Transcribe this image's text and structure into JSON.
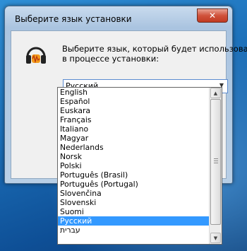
{
  "dialog": {
    "title": "Выберите язык установки",
    "close_glyph": "✕",
    "icon": "headphones-icon",
    "prompt_line1": "Выберите язык, который будет использован",
    "prompt_line2": "в процессе установки:",
    "selected_language": "Русский"
  },
  "languages": [
    "English",
    "Español",
    "Euskara",
    "Français",
    "Italiano",
    "Magyar",
    "Nederlands",
    "Norsk",
    "Polski",
    "Português (Brasil)",
    "Português (Portugal)",
    "Slovenčina",
    "Slovenski",
    "Suomi",
    "Русский",
    "עברית"
  ],
  "colors": {
    "selection": "#3399ff",
    "close_button": "#c13a22"
  }
}
